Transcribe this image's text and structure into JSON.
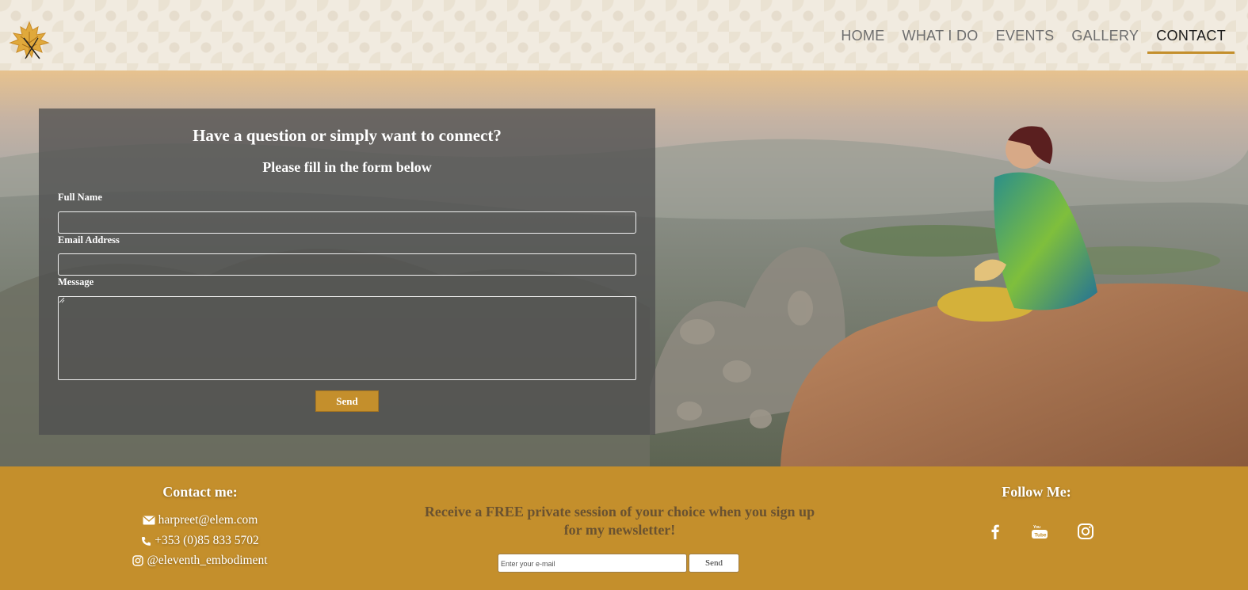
{
  "nav": {
    "items": [
      {
        "label": "HOME"
      },
      {
        "label": "WHAT I DO"
      },
      {
        "label": "EVENTS"
      },
      {
        "label": "GALLERY"
      },
      {
        "label": "CONTACT",
        "active": true
      }
    ]
  },
  "form": {
    "title": "Have a question or simply want to connect?",
    "subtitle": "Please fill in the form below",
    "full_name_label": "Full Name",
    "full_name_value": "",
    "email_label": "Email Address",
    "email_value": "",
    "message_label": "Message",
    "message_value": "",
    "send_label": "Send"
  },
  "footer": {
    "contact_heading": "Contact me:",
    "email": "harpreet@elem.com",
    "phone": "+353 (0)85 833 5702",
    "instagram_handle": "@eleventh_embodiment",
    "newsletter_text": "Receive a FREE private session of your choice when you sign up for my newsletter!",
    "newsletter_placeholder": "Enter your e-mail",
    "newsletter_send_label": "Send",
    "follow_heading": "Follow Me:",
    "social_icons": [
      "facebook-icon",
      "youtube-icon",
      "instagram-icon"
    ]
  },
  "colors": {
    "accent": "#c48f2c",
    "footer_text_dark": "#6a5230",
    "panel_overlay": "rgba(80,80,80,0.78)"
  }
}
